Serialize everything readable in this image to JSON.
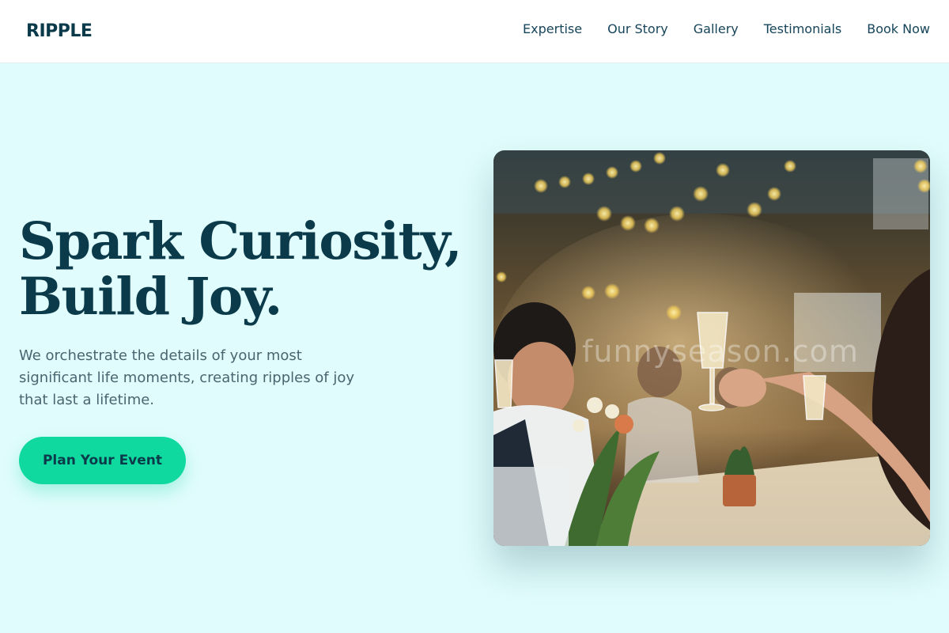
{
  "brand": {
    "logo": "RIPPLE"
  },
  "nav": {
    "items": [
      {
        "label": "Expertise"
      },
      {
        "label": "Our Story"
      },
      {
        "label": "Gallery"
      },
      {
        "label": "Testimonials"
      },
      {
        "label": "Book Now"
      }
    ]
  },
  "hero": {
    "headline_line1": "Spark Curiosity,",
    "headline_line2": "Build Joy.",
    "subtext": "We orchestrate the details of your most significant life moments, creating ripples of joy that last a lifetime.",
    "cta_label": "Plan Your Event",
    "image": {
      "watermark": "funnyseason.com"
    }
  },
  "colors": {
    "page_bg": "#e0fcfc",
    "navy": "#0b3a4a",
    "accent": "#10d9a0",
    "body_text": "#4a6570"
  }
}
